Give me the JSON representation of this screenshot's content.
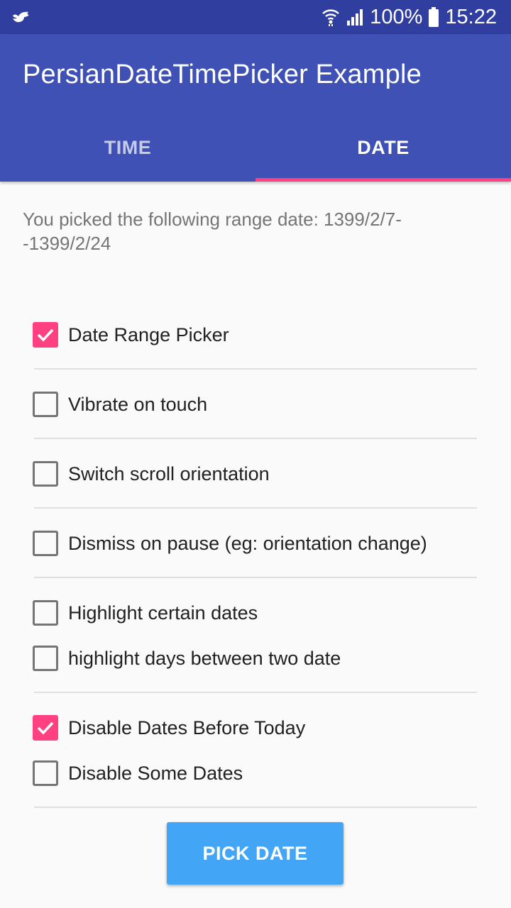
{
  "status_bar": {
    "battery": "100%",
    "time": "15:22",
    "icons": [
      "bird-icon",
      "wifi-icon",
      "signal-icon",
      "battery-icon"
    ]
  },
  "app_bar": {
    "title": "PersianDateTimePicker Example"
  },
  "tabs": [
    {
      "label": "TIME",
      "selected": false
    },
    {
      "label": "DATE",
      "selected": true
    }
  ],
  "content": {
    "picked_text": "You picked the following range date: 1399/2/7--1399/2/24",
    "options": [
      {
        "label": "Date Range Picker",
        "checked": true
      },
      {
        "label": "Vibrate on touch",
        "checked": false
      },
      {
        "label": "Switch scroll orientation",
        "checked": false
      },
      {
        "label": "Dismiss on pause (eg: orientation change)",
        "checked": false
      },
      {
        "label": "Highlight certain dates",
        "checked": false
      },
      {
        "label": "highlight days between two date",
        "checked": false
      },
      {
        "label": "Disable Dates Before Today",
        "checked": true
      },
      {
        "label": "Disable Some Dates",
        "checked": false
      }
    ],
    "button_label": "PICK DATE"
  },
  "colors": {
    "status_bar": "#303f9f",
    "primary": "#3f51b5",
    "accent": "#ff4081",
    "button": "#42a5f5"
  }
}
